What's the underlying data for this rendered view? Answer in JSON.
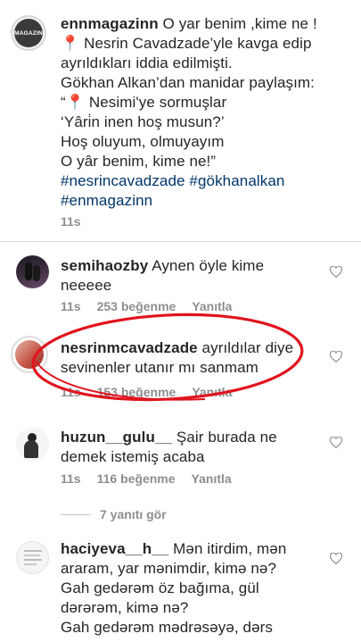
{
  "caption": {
    "username": "ennmagazinn",
    "avatar_text": "MAGAZIN",
    "first_line_rest": " O yar benim ,kime ne !",
    "lines": [
      "📍 Nesrin Cavadzade’yle kavga edip",
      "ayrıldıkları iddia edilmişti.",
      "Gökhan Alkan’dan manidar paylaşım:",
      "“📍 Nesimi'ye sormuşlar",
      "‘Yâri̇n inen hoş musun?’",
      "Hoş oluyum, olmuyayım",
      "O yâr benim, kime ne!”"
    ],
    "hashtags_line1": "#nesrincavadzade #gökhanalkan",
    "hashtags_line2": "#enmagazinn",
    "time": "11s"
  },
  "comments": [
    {
      "username": "semihaozby",
      "text_line1": " Aynen öyle kime",
      "text_line2": "neeeee",
      "time": "11s",
      "likes": "253 beğenme",
      "reply": "Yanıtla"
    },
    {
      "username": "nesrinmcavadzade",
      "text_line1": " ayrıldılar diye",
      "text_line2": "sevinenler utanır mı sanmam",
      "time": "11s",
      "likes": "153 beğenme",
      "reply": "Yanıtla"
    },
    {
      "username": "huzun__gulu__",
      "text_line1": " Şair burada ne",
      "text_line2": "demek istemiş acaba",
      "time": "11s",
      "likes": "116 beğenme",
      "reply": "Yanıtla",
      "view_replies": "7 yanıtı gör"
    },
    {
      "username": "haciyeva__h__",
      "text_line1": " Mən itirdim, mən",
      "text_line2": "araram, yar mənimdir, kimə nə?",
      "text_line3": "Gah gedərəm öz bağıma, gül",
      "text_line4": "dərərəm, kimə nə?",
      "text_line5": "Gah gedərəm mədrəsəyə, dərs"
    }
  ],
  "colors": {
    "text": "#262626",
    "meta": "#8e8e8e",
    "hashtag": "#003569",
    "annotation_circle": "#e0141e",
    "divider": "#dbdbdb"
  }
}
